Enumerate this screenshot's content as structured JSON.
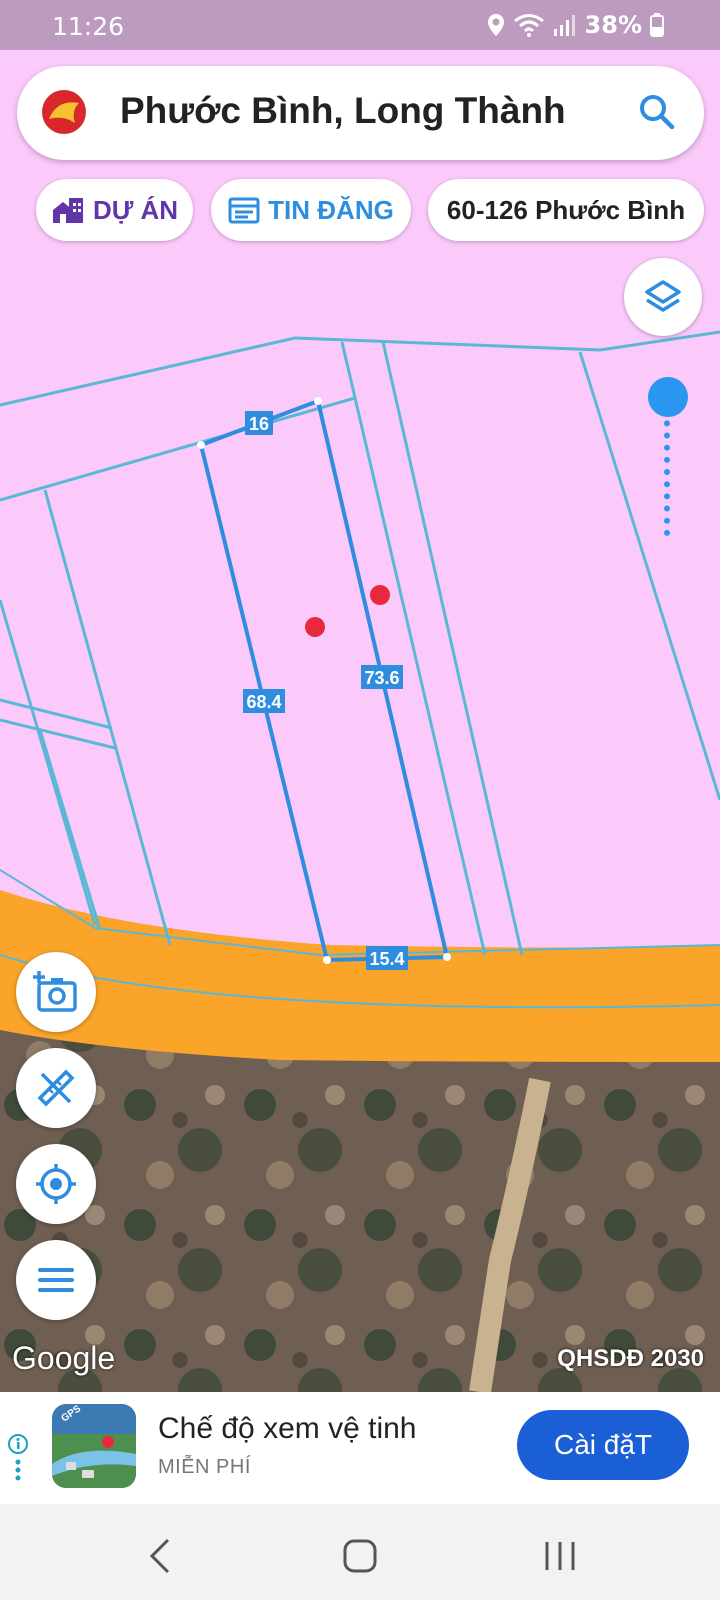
{
  "status_bar": {
    "time": "11:26",
    "battery": "38%"
  },
  "search": {
    "title": "Phước Bình, Long Thành"
  },
  "chips": [
    {
      "label": "DỰ ÁN",
      "icon": "building-icon",
      "color": "#6236a8"
    },
    {
      "label": "TIN ĐĂNG",
      "icon": "listing-icon",
      "color": "#2f8de0"
    },
    {
      "label": "60-126 Phước Bình"
    }
  ],
  "map": {
    "plot_edges": {
      "top": "16",
      "left": "68.4",
      "right": "73.6",
      "bottom": "15.4"
    },
    "attribution": "Google",
    "plan_label": "QHSDĐ 2030",
    "colors": {
      "land": "#fcc9fb",
      "road": "#fba42a",
      "parcel_line": "#5ab8d6",
      "plot_line": "#2f8de0",
      "marker": "#e8283c"
    }
  },
  "fabs": [
    {
      "name": "add-photo-button",
      "icon": "camera-plus-icon"
    },
    {
      "name": "measure-button",
      "icon": "ruler-pencil-icon"
    },
    {
      "name": "locate-button",
      "icon": "crosshair-icon"
    },
    {
      "name": "menu-button",
      "icon": "menu-icon"
    }
  ],
  "ad": {
    "title": "Chế độ xem vệ tinh",
    "subtitle": "MIỄN PHÍ",
    "install_label": "Cài đặT",
    "app_icon_badge": "GPS"
  },
  "nav": {
    "back": "back-icon",
    "home": "home-icon",
    "recents": "recents-icon"
  }
}
